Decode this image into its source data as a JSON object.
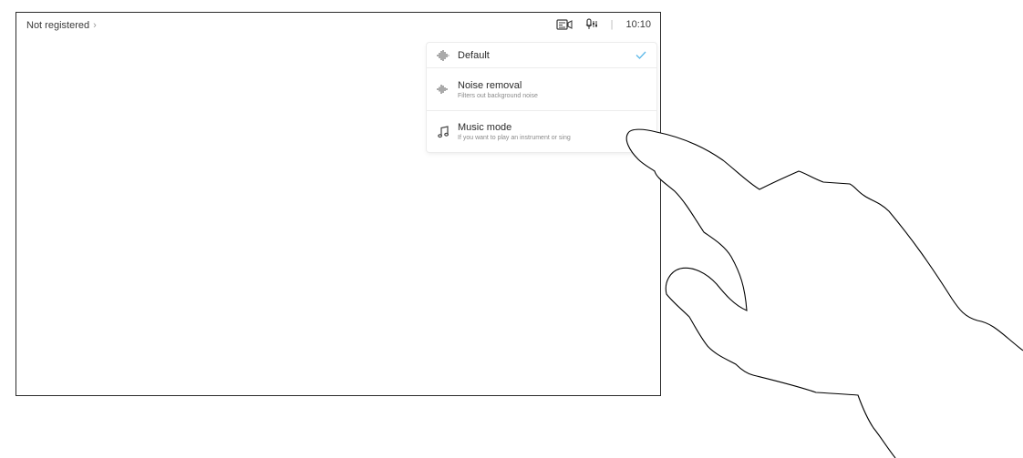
{
  "status_bar": {
    "registration": "Not registered",
    "chevron": "›",
    "time": "10:10",
    "separator": "|",
    "icons": [
      "self-view-icon",
      "microphone-settings-icon"
    ]
  },
  "audio_menu": {
    "items": [
      {
        "title": "Default",
        "subtitle": "",
        "icon": "waveform-icon",
        "selected": true
      },
      {
        "title": "Noise removal",
        "subtitle": "Filters out background noise",
        "icon": "noise-waveform-icon",
        "selected": false
      },
      {
        "title": "Music mode",
        "subtitle": "If you want to play an instrument or sing",
        "icon": "music-note-icon",
        "selected": false
      }
    ],
    "check_color": "#5bb8e8"
  }
}
